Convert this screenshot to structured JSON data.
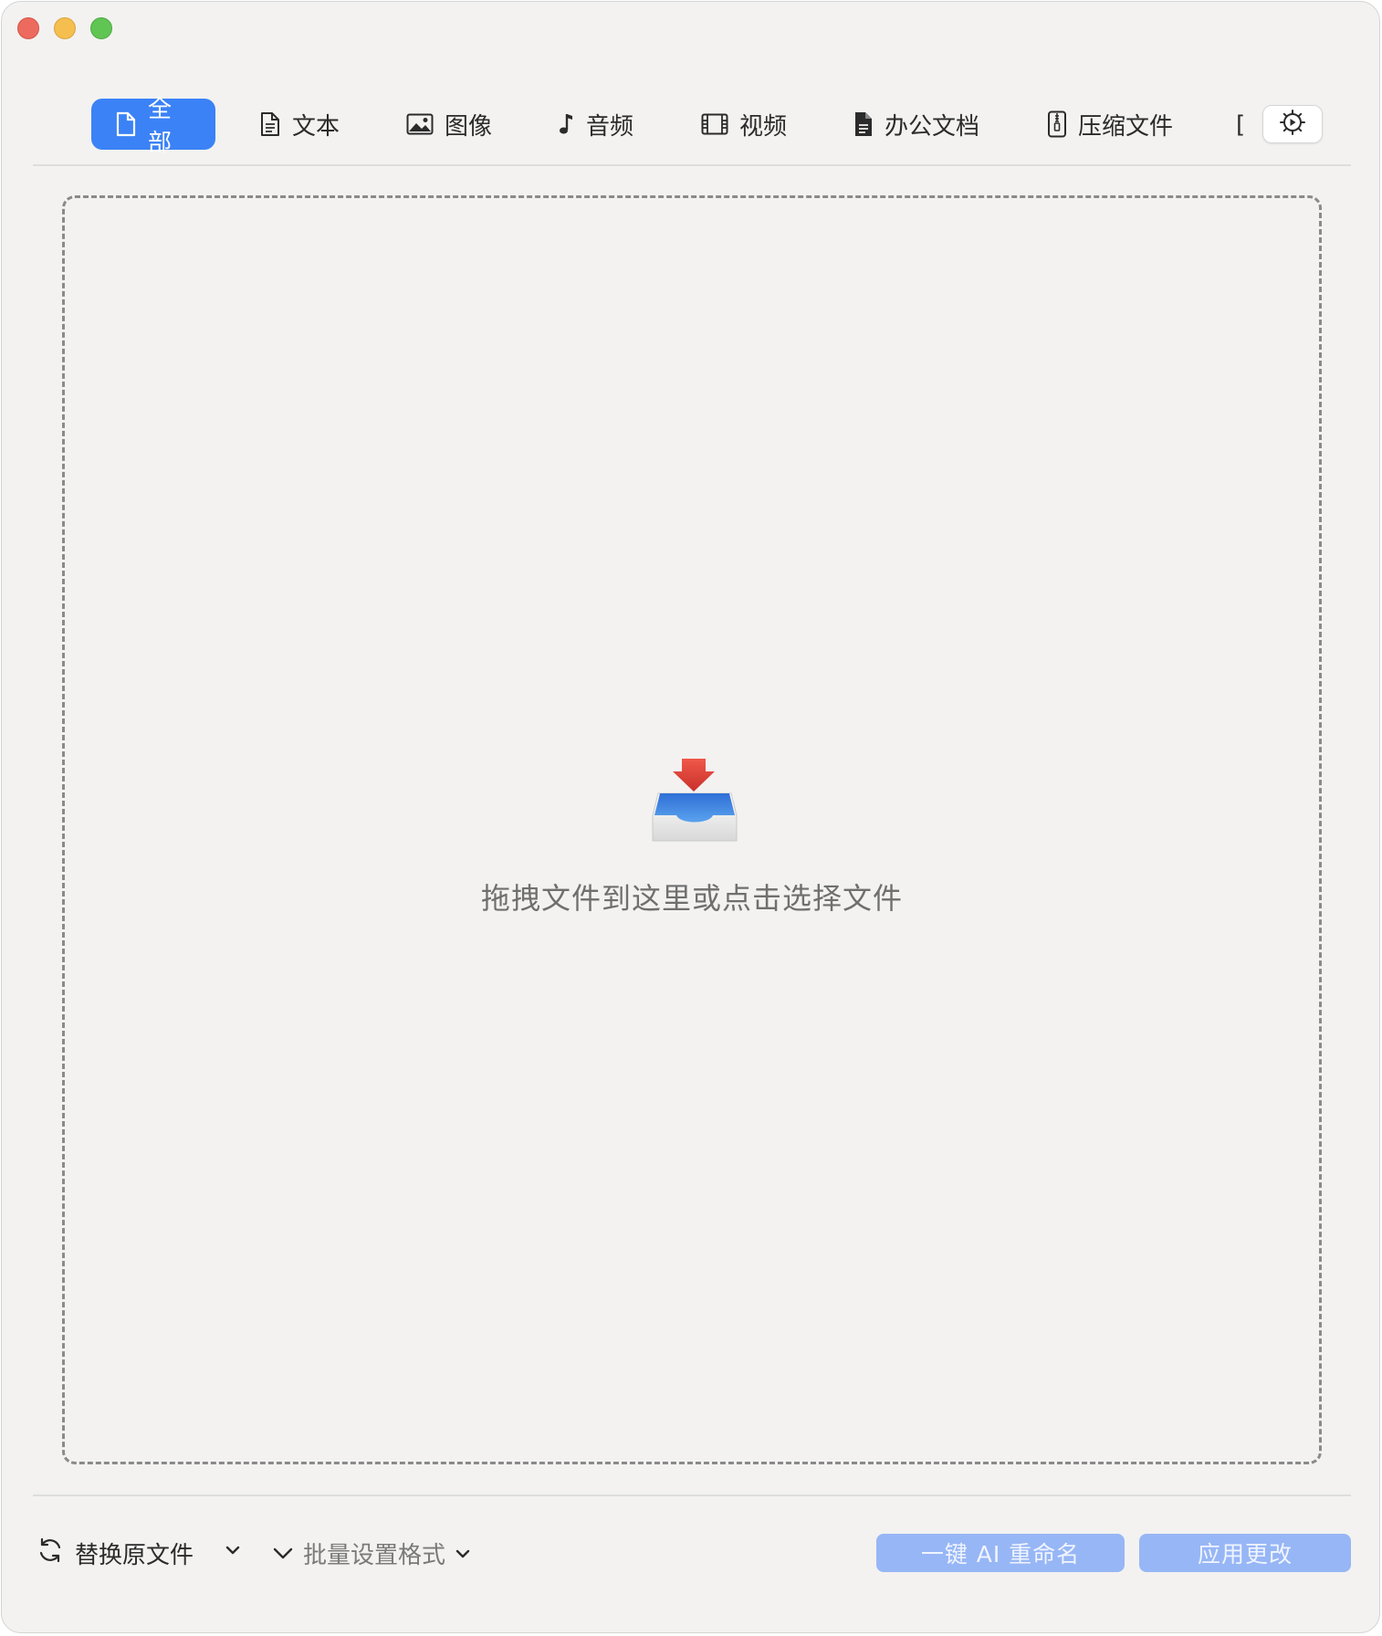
{
  "window": {
    "traffic_lights": [
      "close",
      "minimize",
      "maximize"
    ]
  },
  "tabs": [
    {
      "label": "全部",
      "icon": "document-icon",
      "active": true
    },
    {
      "label": "文本",
      "icon": "text-document-icon",
      "active": false
    },
    {
      "label": "图像",
      "icon": "image-icon",
      "active": false
    },
    {
      "label": "音频",
      "icon": "music-note-icon",
      "active": false
    },
    {
      "label": "视频",
      "icon": "film-icon",
      "active": false
    },
    {
      "label": "办公文档",
      "icon": "filled-document-icon",
      "active": false
    },
    {
      "label": "压缩文件",
      "icon": "zip-icon",
      "active": false
    }
  ],
  "tab_overflow": "[",
  "settings": {
    "icon": "gear-icon"
  },
  "dropzone": {
    "icon": "tray-download-icon",
    "text": "拖拽文件到这里或点击选择文件"
  },
  "bottom": {
    "replace_label": "替换原文件",
    "replace_icon": "refresh-icon",
    "batch_label": "批量设置格式",
    "ai_rename_label": "一键 AI 重命名",
    "apply_label": "应用更改"
  },
  "colors": {
    "accent": "#3b82f6",
    "disabled_button": "#97b6f5",
    "window_bg": "#f3f2f1"
  }
}
